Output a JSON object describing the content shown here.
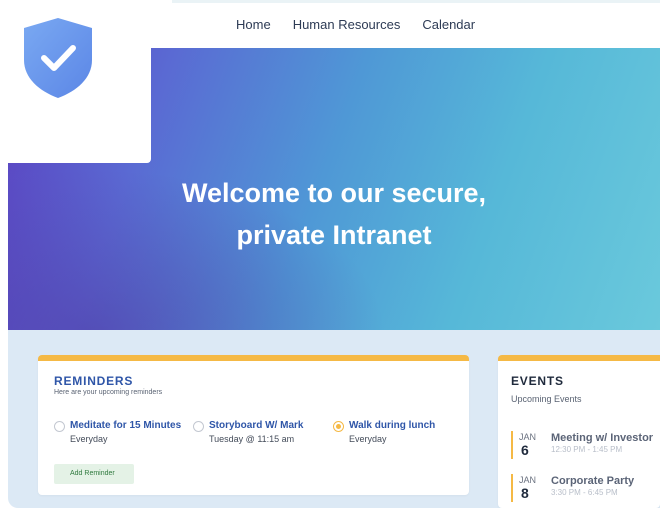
{
  "nav": {
    "items": [
      "Home",
      "Human Resources",
      "Calendar"
    ]
  },
  "logo": {
    "icon": "shield-check-icon",
    "color": "#6f9ef0"
  },
  "hero": {
    "line1": "Welcome to our secure,",
    "line2": "private Intranet"
  },
  "reminders": {
    "title": "REMINDERS",
    "subtitle": "Here are your upcoming reminders",
    "items": [
      {
        "title": "Meditate for 15 Minutes",
        "schedule": "Everyday",
        "checked": false
      },
      {
        "title": "Storyboard W/ Mark",
        "schedule": "Tuesday @ 11:15 am",
        "checked": false
      },
      {
        "title": "Walk during lunch",
        "schedule": "Everyday",
        "checked": true
      }
    ],
    "add_label": "Add Reminder"
  },
  "events": {
    "title": "EVENTS",
    "subtitle": "Upcoming Events",
    "items": [
      {
        "month": "JAN",
        "day": "6",
        "title": "Meeting w/ Investor",
        "time": "12:30 PM - 1:45 PM"
      },
      {
        "month": "JAN",
        "day": "8",
        "title": "Corporate Party",
        "time": "3:30 PM - 6:45 PM"
      }
    ]
  },
  "colors": {
    "accent": "#f5b945",
    "primary_text": "#2f56a8",
    "content_bg": "#dce9f5"
  }
}
